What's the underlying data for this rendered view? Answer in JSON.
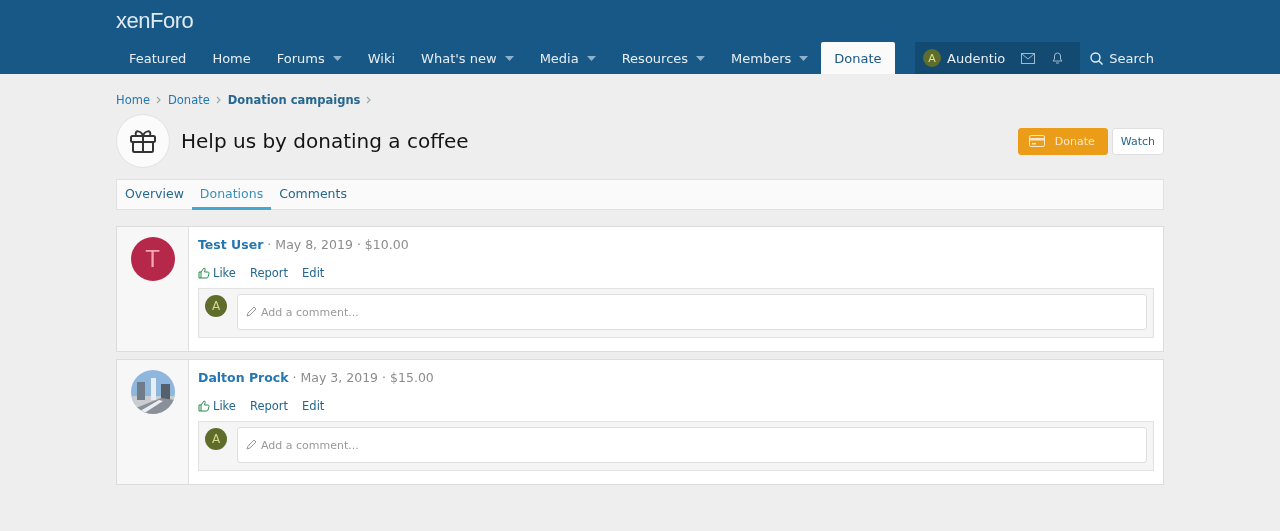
{
  "header": {
    "logo": "xenForo",
    "nav": [
      {
        "label": "Featured",
        "has_menu": false,
        "selected": false
      },
      {
        "label": "Home",
        "has_menu": false,
        "selected": false
      },
      {
        "label": "Forums",
        "has_menu": true,
        "selected": false
      },
      {
        "label": "Wiki",
        "has_menu": false,
        "selected": false
      },
      {
        "label": "What's new",
        "has_menu": true,
        "selected": false
      },
      {
        "label": "Media",
        "has_menu": true,
        "selected": false
      },
      {
        "label": "Resources",
        "has_menu": true,
        "selected": false
      },
      {
        "label": "Members",
        "has_menu": true,
        "selected": false
      },
      {
        "label": "Donate",
        "has_menu": false,
        "selected": true
      }
    ],
    "user": {
      "avatar_letter": "A",
      "name": "Audentio"
    },
    "search": "Search"
  },
  "breadcrumbs": [
    {
      "label": "Home",
      "current": false
    },
    {
      "label": "Donate",
      "current": false
    },
    {
      "label": "Donation campaigns",
      "current": true
    }
  ],
  "page": {
    "title": "Help us by donating a coffee",
    "buttons": [
      {
        "label": "Donate",
        "kind": "primary"
      },
      {
        "label": "Watch",
        "kind": "plain"
      }
    ]
  },
  "tabs": [
    {
      "label": "Overview",
      "selected": false
    },
    {
      "label": "Donations",
      "selected": true
    },
    {
      "label": "Comments",
      "selected": false
    }
  ],
  "donations": [
    {
      "avatar": {
        "kind": "letter",
        "letter": "T",
        "color": "#b5284a"
      },
      "name": "Test User",
      "separator": "·",
      "date": "May 8, 2019",
      "amount": "$10.00",
      "actions": [
        "Like",
        "Report",
        "Edit"
      ],
      "comment": {
        "avatar_letter": "A",
        "placeholder": "Add a comment..."
      }
    },
    {
      "name": "Dalton Prock",
      "separator": "·",
      "date": "May 3, 2019",
      "amount": "$15.00",
      "actions": [
        "Like",
        "Report",
        "Edit"
      ],
      "comment": {
        "avatar_letter": "A",
        "placeholder": "Add a comment..."
      }
    }
  ]
}
